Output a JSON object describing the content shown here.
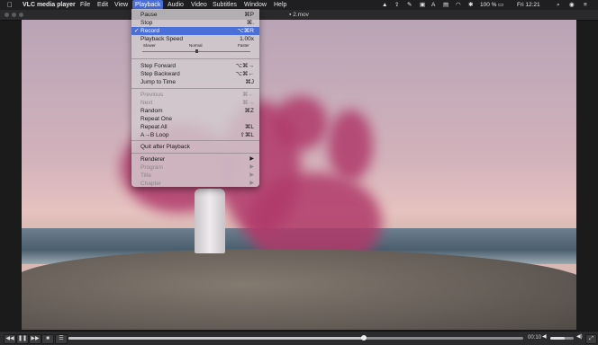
{
  "menubar": {
    "apple_icon": "apple-icon",
    "app_name": "VLC media player",
    "items": [
      "File",
      "Edit",
      "View",
      "Playback",
      "Audio",
      "Video",
      "Subtitles",
      "Window",
      "Help"
    ],
    "active_item": "Playback",
    "status": {
      "battery": "100 %",
      "clock": "Fri 12:21"
    }
  },
  "window": {
    "title": "2.mov",
    "file_icon": "video-file-icon"
  },
  "playback_menu": {
    "pause": {
      "label": "Pause",
      "shortcut": "⌘P"
    },
    "stop": {
      "label": "Stop",
      "shortcut": "⌘."
    },
    "record": {
      "label": "Record",
      "shortcut": "⌥⌘R",
      "checked": "✓"
    },
    "playback_speed": {
      "label": "Playback Speed",
      "value": "1.00x",
      "slower": "Slower",
      "normal": "Normal",
      "faster": "Faster"
    },
    "step_forward": {
      "label": "Step Forward",
      "shortcut": "⌥⌘→"
    },
    "step_backward": {
      "label": "Step Backward",
      "shortcut": "⌥⌘←"
    },
    "jump_to_time": {
      "label": "Jump to Time",
      "shortcut": "⌘J"
    },
    "previous": {
      "label": "Previous",
      "shortcut": "⌘←"
    },
    "next": {
      "label": "Next",
      "shortcut": "⌘→"
    },
    "random": {
      "label": "Random",
      "shortcut": "⌘Z"
    },
    "repeat_one": {
      "label": "Repeat One"
    },
    "repeat_all": {
      "label": "Repeat All",
      "shortcut": "⌘L"
    },
    "ab_loop": {
      "label": "A→B Loop",
      "shortcut": "⇧⌘L"
    },
    "quit_after": {
      "label": "Quit after Playback"
    },
    "renderer": {
      "label": "Renderer"
    },
    "program": {
      "label": "Program"
    },
    "title": {
      "label": "Title"
    },
    "chapter": {
      "label": "Chapter"
    }
  },
  "controls": {
    "rewind": "◀◀",
    "play_pause": "❚❚",
    "forward": "▶▶",
    "stop": "■",
    "playlist": "☰",
    "time": "00:10",
    "progress": 0.65,
    "volume": 0.6,
    "fullscreen": "⤢"
  }
}
